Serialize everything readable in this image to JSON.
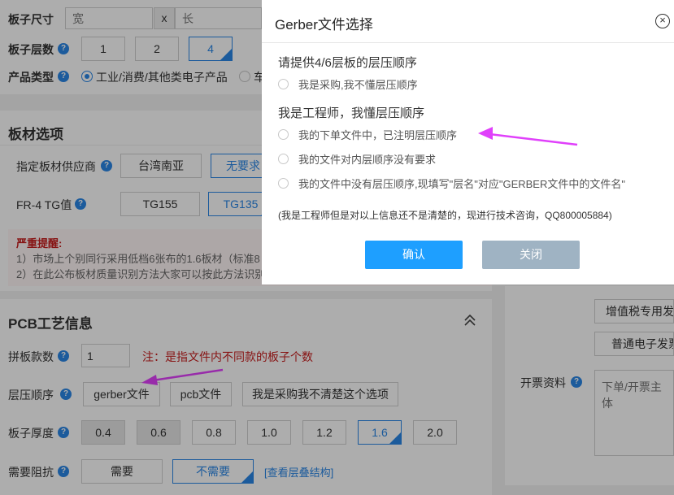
{
  "board_size": {
    "label": "板子尺寸",
    "width_placeholder": "宽",
    "x_sep": "x",
    "length_placeholder": "长"
  },
  "layers": {
    "label": "板子层数",
    "options": [
      "1",
      "2",
      "4"
    ]
  },
  "product_type": {
    "label": "产品类型",
    "options": [
      "工业/消费/其他类电子产品",
      "车"
    ]
  },
  "material_section": {
    "title": "板材选项",
    "supplier": {
      "label": "指定板材供应商",
      "options": [
        "台湾南亚",
        "无要求"
      ]
    },
    "tg": {
      "label": "FR-4 TG值",
      "options": [
        "TG155",
        "TG135"
      ]
    },
    "warning": {
      "title": "严重提醒:",
      "line1": "1）市场上个别同行采用低档6张布的1.6板材（标准8",
      "line2": "2）在此公布板材质量识别方法大家可以按此方法识别"
    }
  },
  "pcb_section": {
    "title": "PCB工艺信息",
    "panel_count": {
      "label": "拼板款数",
      "value": "1",
      "note": "注：是指文件内不同款的板子个数"
    },
    "stack_order": {
      "label": "层压顺序",
      "options": [
        "gerber文件",
        "pcb文件",
        "我是采购我不清楚这个选项"
      ]
    },
    "thickness": {
      "label": "板子厚度",
      "options": [
        "0.4",
        "0.6",
        "0.8",
        "1.0",
        "1.2",
        "1.6",
        "2.0"
      ]
    },
    "impedance": {
      "label": "需要阻抗",
      "options": [
        "需要",
        "不需要"
      ],
      "link": "[查看层叠结构]"
    }
  },
  "invoice": {
    "vat_special": "增值税专用发",
    "normal_e": "普通电子发票",
    "label": "开票资料",
    "placeholder": "下单/开票主体"
  },
  "dialog": {
    "title": "Gerber文件选择",
    "close_icon": "×",
    "question": "请提供4/6层板的层压顺序",
    "opt_buyer": "我是采购,我不懂层压顺序",
    "engineer_heading": "我是工程师，我懂层压顺序",
    "opt_in_order": "我的下单文件中，已注明层压顺序",
    "opt_no_req": "我的文件对内层顺序没有要求",
    "opt_manual": "我的文件中没有层压顺序,现填写\"层名\"对应\"GERBER文件中的文件名\"",
    "note": "(我是工程师但是对以上信息还不是清楚的，现进行技术咨询，QQ800005884)",
    "confirm": "确认",
    "close": "关闭"
  },
  "colors": {
    "accent": "#2a86e6",
    "confirm": "#1e9fff",
    "close_btn": "#9fb3c3",
    "arrow": "#e040fb",
    "warning": "#c81e1e"
  }
}
